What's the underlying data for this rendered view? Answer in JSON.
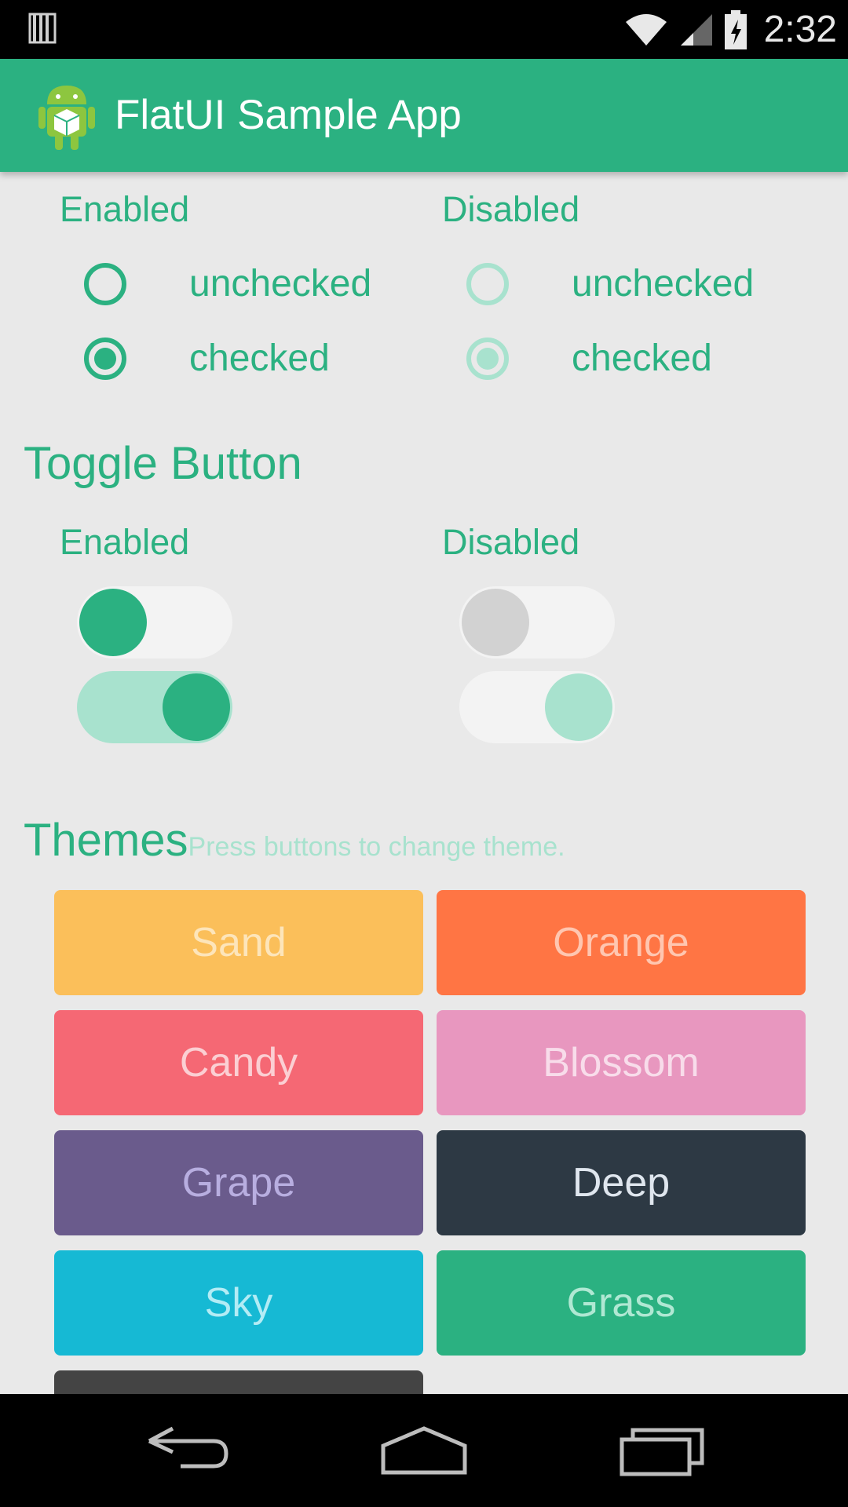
{
  "status_bar": {
    "time": "2:32",
    "icons": [
      "sd-card-icon",
      "wifi-icon",
      "signal-icon",
      "battery-charging-icon"
    ]
  },
  "app_bar": {
    "title": "FlatUI Sample App",
    "icon": "android-app-icon"
  },
  "radio_section": {
    "enabled_label": "Enabled",
    "disabled_label": "Disabled",
    "unchecked_label": "unchecked",
    "checked_label": "checked"
  },
  "toggle_section": {
    "title": "Toggle Button",
    "enabled_label": "Enabled",
    "disabled_label": "Disabled"
  },
  "themes_section": {
    "title": "Themes",
    "hint": "Press buttons to change theme.",
    "buttons": [
      {
        "label": "Sand",
        "bg": "#fbbf5a",
        "fg": "#fde5ba"
      },
      {
        "label": "Orange",
        "bg": "#ff7544",
        "fg": "#ffc6b0"
      },
      {
        "label": "Candy",
        "bg": "#f56874",
        "fg": "#fbcfd3"
      },
      {
        "label": "Blossom",
        "bg": "#e897bf",
        "fg": "#f8dcea"
      },
      {
        "label": "Grape",
        "bg": "#6a5b8c",
        "fg": "#b8aee0"
      },
      {
        "label": "Deep",
        "bg": "#2d3944",
        "fg": "#dfe6ee"
      },
      {
        "label": "Sky",
        "bg": "#16b9d4",
        "fg": "#b3ecf5"
      },
      {
        "label": "Grass",
        "bg": "#2bb181",
        "fg": "#b0e8d3"
      }
    ]
  },
  "colors": {
    "accent": "#2bb181",
    "accent_light": "#a8e2ce",
    "background": "#e9e9e9"
  }
}
